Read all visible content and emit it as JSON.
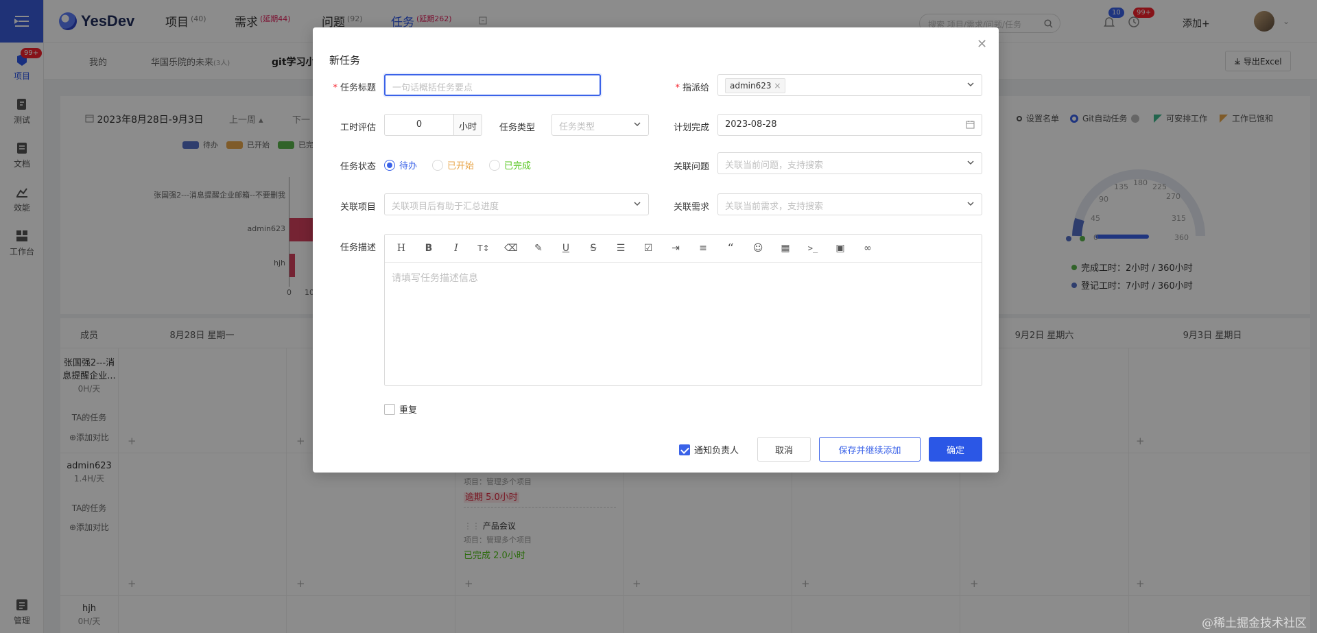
{
  "app": {
    "name": "YesDev"
  },
  "rail": {
    "items": [
      {
        "label": "项目",
        "badge": "99+"
      },
      {
        "label": "测试"
      },
      {
        "label": "文档"
      },
      {
        "label": "效能"
      },
      {
        "label": "工作台"
      },
      {
        "label": "管理"
      }
    ]
  },
  "nav": {
    "items": [
      {
        "label": "项目",
        "count": "(40)"
      },
      {
        "label": "需求",
        "count": "(延期44)"
      },
      {
        "label": "问题",
        "count": "(92)"
      },
      {
        "label": "任务",
        "count": "(延期262)"
      }
    ]
  },
  "header": {
    "search_placeholder": "搜索 项目/需求/问题/任务",
    "bell_badge": "10",
    "clock_badge": "99+",
    "add_label": "添加+"
  },
  "subtabs": {
    "items": [
      "我的",
      "华国乐院的未来",
      "(3人)",
      "git学习小"
    ],
    "export_label": "导出Excel"
  },
  "stats": {
    "range": "2023年8月28日-9月3日",
    "prev": "上一周",
    "next": "下一",
    "legend": [
      "待办",
      "已开始",
      "已完"
    ],
    "options": [
      "设置名单",
      "Git自动任务",
      "可安排工作",
      "工作已饱和"
    ],
    "bar_rows": [
      "张国强2---消息提醒企业邮箱--不要删我",
      "admin623",
      "hjh"
    ],
    "ticks": [
      "0",
      "10"
    ],
    "gauge_ticks": [
      "0",
      "45",
      "90",
      "135",
      "180",
      "225",
      "270",
      "315",
      "360"
    ],
    "done_hours": "完成工时：2小时 / 360小时",
    "logged_hours": "登记工时：7小时 / 360小时"
  },
  "calendar": {
    "columns": [
      "成员",
      "8月28日 星期一",
      "9月2日 星期六",
      "9月3日 星期日"
    ],
    "members": [
      {
        "name": "张国强2---消息提醒企业...",
        "rate": "0H/天",
        "tasks": "TA的任务",
        "compare": "添加对比"
      },
      {
        "name": "admin623",
        "rate": "1.4H/天",
        "tasks": "TA的任务",
        "compare": "添加对比"
      },
      {
        "name": "hjh",
        "rate": "0H/天"
      }
    ],
    "cards": [
      {
        "project": "项目：管理多个项目",
        "status": "逾期 5.0小时"
      },
      {
        "title": "产品会议",
        "project": "项目：管理多个项目",
        "status": "已完成 2.0小时"
      }
    ]
  },
  "modal": {
    "title": "新任务",
    "fields": {
      "title_label": "任务标题",
      "title_placeholder": "一句话概括任务要点",
      "assignee_label": "指派给",
      "assignee_tag": "admin623",
      "estimate_label": "工时评估",
      "estimate_value": "0",
      "estimate_unit": "小时",
      "type_label": "任务类型",
      "type_placeholder": "任务类型",
      "due_label": "计划完成",
      "due_value": "2023-08-28",
      "status_label": "任务状态",
      "status_options": [
        "待办",
        "已开始",
        "已完成"
      ],
      "issue_label": "关联问题",
      "issue_placeholder": "关联当前问题，支持搜索",
      "project_label": "关联项目",
      "project_placeholder": "关联项目后有助于汇总进度",
      "req_label": "关联需求",
      "req_placeholder": "关联当前需求，支持搜索",
      "desc_label": "任务描述",
      "desc_placeholder": "请填写任务描述信息"
    },
    "repeat_label": "重复",
    "notify_label": "通知负责人",
    "cancel_label": "取消",
    "save_continue_label": "保存并继续添加",
    "confirm_label": "确定"
  },
  "watermark": "@稀土掘金技术社区",
  "colors": {
    "accent": "#2b57e6",
    "todo": "#5470c6",
    "started": "#e8a64b",
    "done": "#59b44b",
    "late": "#d9263c"
  }
}
